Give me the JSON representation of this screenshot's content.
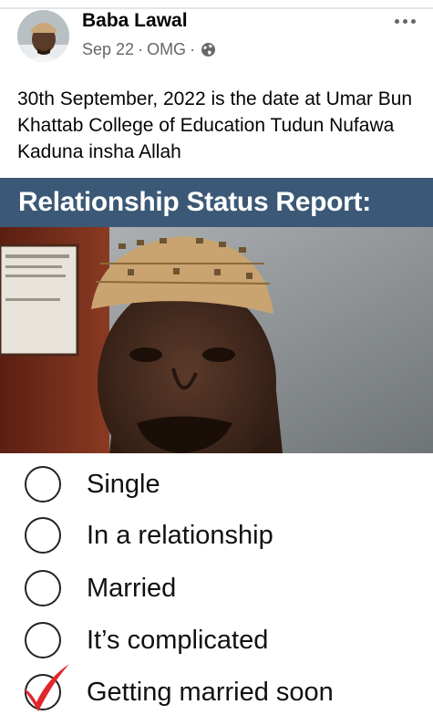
{
  "post": {
    "author": "Baba Lawal",
    "date": "Sep 22",
    "group": "OMG",
    "separator": "·",
    "privacy_icon": "globe-icon",
    "more_icon": "more-options-icon",
    "text": "30th September, 2022 is the date at Umar Bun Khattab College of Education Tudun Nufawa Kaduna insha Allah"
  },
  "card": {
    "banner_title": "Relationship Status Report:",
    "options": [
      {
        "label": "Single",
        "checked": false
      },
      {
        "label": "In a relationship",
        "checked": false
      },
      {
        "label": "Married",
        "checked": false
      },
      {
        "label": "It’s complicated",
        "checked": false
      },
      {
        "label": "Getting married soon",
        "checked": true
      }
    ]
  },
  "colors": {
    "banner": "#3b5876",
    "check": "#e0262b",
    "meta_text": "#65676b"
  }
}
